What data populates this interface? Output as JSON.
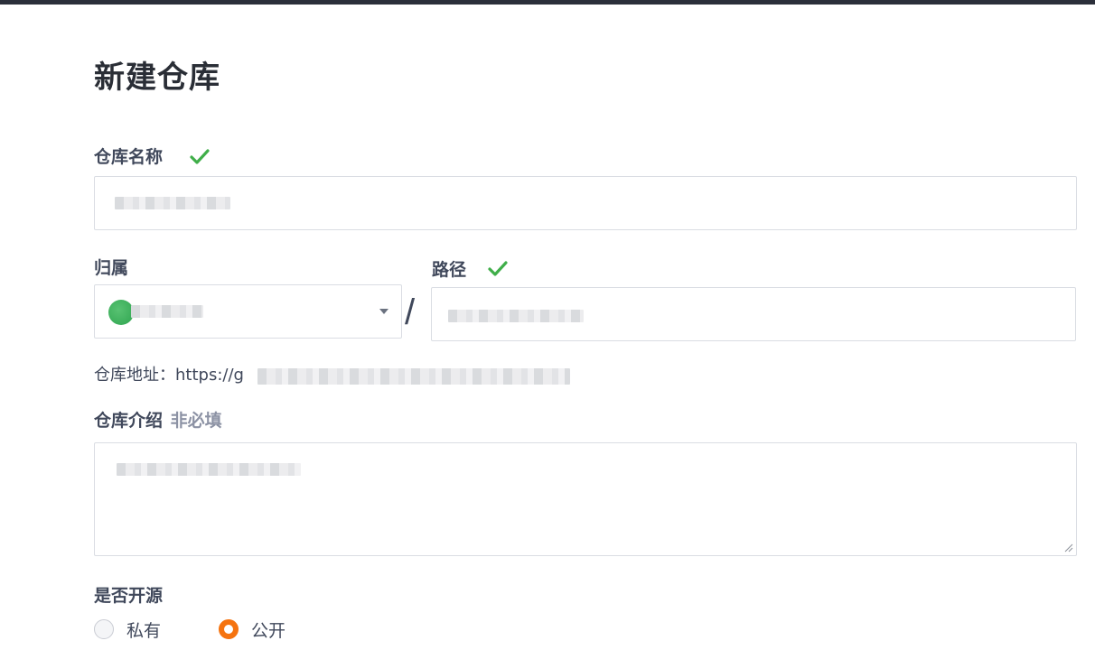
{
  "page": {
    "title": "新建仓库"
  },
  "repo_name": {
    "label": "仓库名称",
    "value": "",
    "status": "valid"
  },
  "owner": {
    "label": "归属",
    "selected": ""
  },
  "path": {
    "label": "路径",
    "value": "",
    "status": "valid"
  },
  "separator": "/",
  "repo_url": {
    "label": "仓库地址：",
    "value": "https://g"
  },
  "description": {
    "label": "仓库介绍",
    "optional_hint": "非必填",
    "value": ""
  },
  "visibility": {
    "label": "是否开源",
    "options": [
      {
        "label": "私有",
        "selected": false
      },
      {
        "label": "公开",
        "selected": true
      }
    ]
  },
  "colors": {
    "accent": "#f5730f",
    "check": "#3fae49",
    "text": "#40485b",
    "topbar": "#2b2f3a"
  },
  "icons": {
    "valid": "check-icon",
    "select": "chevron-down-icon",
    "resize": "resize-handle-icon"
  }
}
